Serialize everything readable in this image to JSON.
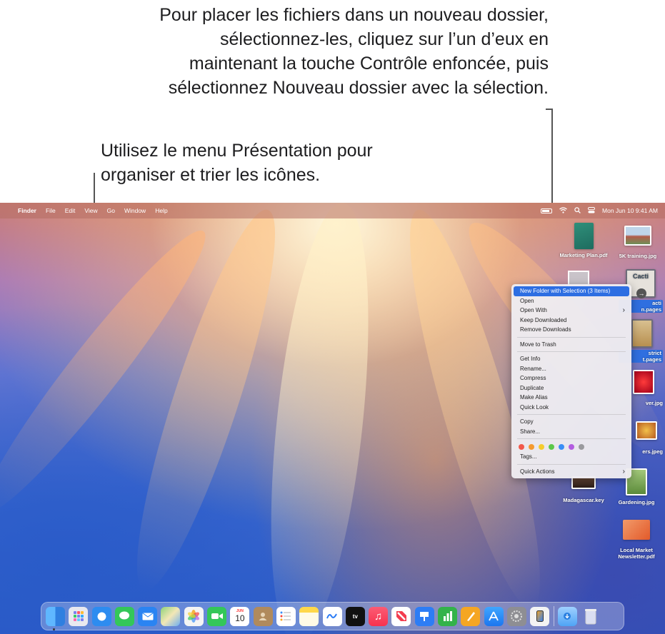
{
  "callouts": {
    "top": "Pour placer les fichiers dans un nouveau dossier, sélectionnez-les, cliquez sur l’un d’eux en maintenant la touche Contrôle enfoncée, puis sélectionnez Nouveau dossier avec la sélection.",
    "left": "Utilisez le menu Présentation pour organiser et trier les icônes."
  },
  "menubar": {
    "app": "Finder",
    "items": [
      "File",
      "Edit",
      "View",
      "Go",
      "Window",
      "Help"
    ],
    "clock": "Mon Jun 10  9:41 AM"
  },
  "desktop": {
    "icons": [
      {
        "label": "Marketing Plan.pdf"
      },
      {
        "label": "5K training.jpg"
      },
      {
        "label": "acti\nn.pages"
      },
      {
        "label": "strict\nt.pages"
      },
      {
        "label": "ver.jpg"
      },
      {
        "label": "ers.jpeg"
      },
      {
        "label": "Madagascar.key"
      },
      {
        "label": "Gardening.jpg"
      },
      {
        "label": "Local Market\nNewsletter.pdf"
      }
    ],
    "thumb_text": {
      "cacti": "Cacti"
    }
  },
  "context_menu": {
    "group1": [
      {
        "label": "New Folder with Selection (3 Items)",
        "highlight": true
      },
      {
        "label": "Open"
      },
      {
        "label": "Open With",
        "submenu": true
      },
      {
        "label": "Keep Downloaded"
      },
      {
        "label": "Remove Downloads"
      }
    ],
    "group2": [
      {
        "label": "Move to Trash"
      }
    ],
    "group3": [
      {
        "label": "Get Info"
      },
      {
        "label": "Rename..."
      },
      {
        "label": "Compress"
      },
      {
        "label": "Duplicate"
      },
      {
        "label": "Make Alias"
      },
      {
        "label": "Quick Look"
      }
    ],
    "group4": [
      {
        "label": "Copy"
      },
      {
        "label": "Share..."
      }
    ],
    "tag_colors": [
      "#f2594b",
      "#f59a2e",
      "#f5cc2e",
      "#5cc84a",
      "#3a8ef6",
      "#b35de0",
      "#9a9a9e"
    ],
    "tags_label": "Tags...",
    "quick_actions": "Quick Actions"
  },
  "dock": {
    "apps": [
      {
        "name": "finder",
        "color": "#2f8cf0"
      },
      {
        "name": "launchpad",
        "color": "#7b7ff0"
      },
      {
        "name": "safari",
        "color": "#2d8cf0"
      },
      {
        "name": "messages",
        "color": "#34c759"
      },
      {
        "name": "mail",
        "color": "#2a84f2"
      },
      {
        "name": "maps",
        "color": "#5fb85a"
      },
      {
        "name": "photos",
        "color": "#f4f4f4"
      },
      {
        "name": "facetime",
        "color": "#34c759"
      },
      {
        "name": "calendar",
        "color": "#ffffff"
      },
      {
        "name": "contacts",
        "color": "#b08a5c"
      },
      {
        "name": "reminders",
        "color": "#ffffff"
      },
      {
        "name": "notes",
        "color": "#ffd84a"
      },
      {
        "name": "freeform",
        "color": "#ffffff"
      },
      {
        "name": "tv",
        "color": "#111111"
      },
      {
        "name": "music",
        "color": "#f7425a"
      },
      {
        "name": "news",
        "color": "#f33d4f"
      },
      {
        "name": "keynote",
        "color": "#2d7df5"
      },
      {
        "name": "numbers",
        "color": "#33b34a"
      },
      {
        "name": "pages",
        "color": "#f5a623"
      },
      {
        "name": "app-store",
        "color": "#2b8ef6"
      },
      {
        "name": "system-settings",
        "color": "#8e8e93"
      },
      {
        "name": "iphone-mirroring",
        "color": "#f3f3f3"
      }
    ],
    "calendar": {
      "month": "JUN",
      "day": "10"
    },
    "tv_label": "tv"
  }
}
